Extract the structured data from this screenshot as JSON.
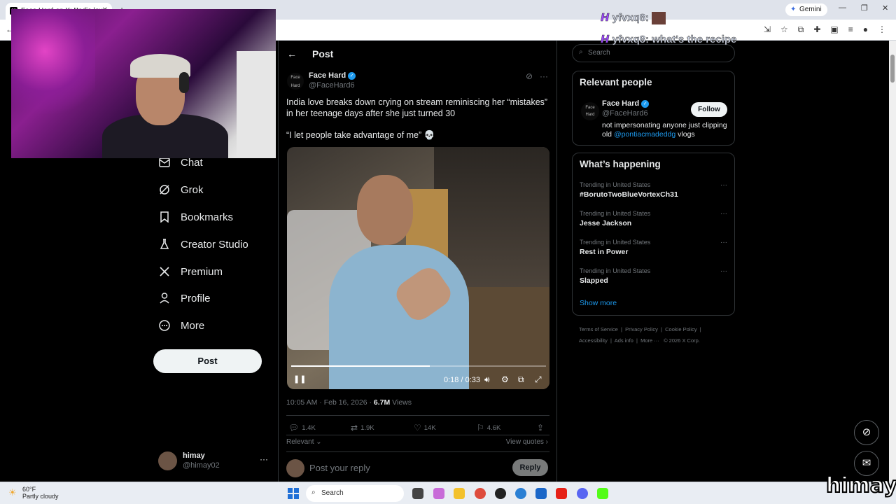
{
  "browser": {
    "tab_title": "Face Hard on X: \"India lov",
    "gemini_label": "Gemini"
  },
  "nav": {
    "items": [
      {
        "label": "Chat",
        "icon": "mail-icon"
      },
      {
        "label": "Grok",
        "icon": "grok-icon"
      },
      {
        "label": "Bookmarks",
        "icon": "bookmark-icon"
      },
      {
        "label": "Creator Studio",
        "icon": "flask-icon"
      },
      {
        "label": "Premium",
        "icon": "x-logo-icon"
      },
      {
        "label": "Profile",
        "icon": "person-icon"
      },
      {
        "label": "More",
        "icon": "more-circle-icon"
      }
    ],
    "post_button": "Post",
    "account": {
      "name": "himay",
      "handle": "@himay02"
    }
  },
  "post": {
    "header_title": "Post",
    "author": {
      "name": "Face Hard",
      "handle": "@FaceHard6",
      "avatar_text": "Face Hard"
    },
    "text": "India love breaks down crying on stream reminiscing her “mistakes” in her teenage days after she just turned 30",
    "quote": "“I let people take advantage of me” 💀",
    "video": {
      "time": "0:18 / 0:33",
      "progress": 0.545
    },
    "timestamp": "10:05 AM · Feb 16, 2026 · ",
    "views_count": "6.7M",
    "views_label": " Views",
    "stats": {
      "replies": "1.4K",
      "reposts": "1.9K",
      "likes": "14K",
      "bookmarks": "4.6K"
    },
    "sort_label": "Relevant",
    "view_quotes": "View quotes",
    "reply_placeholder": "Post your reply",
    "reply_button": "Reply"
  },
  "sidebar": {
    "search_placeholder": "Search",
    "relevant": {
      "title": "Relevant people",
      "name": "Face Hard",
      "handle": "@FaceHard6",
      "follow": "Follow",
      "bio_pre": "not impersonating anyone just clipping old ",
      "bio_link": "@pontiacmadeddg",
      "bio_post": " vlogs"
    },
    "happening": {
      "title": "What’s happening",
      "trends": [
        {
          "context": "Trending in United States",
          "title": "#BorutoTwoBlueVortexCh31"
        },
        {
          "context": "Trending in United States",
          "title": "Jesse Jackson"
        },
        {
          "context": "Trending in United States",
          "title": "Rest in Power"
        },
        {
          "context": "Trending in United States",
          "title": "Slapped"
        }
      ],
      "show_more": "Show more"
    },
    "footer_links": [
      "Terms of Service",
      "Privacy Policy",
      "Cookie Policy",
      "Accessibility",
      "Ads info",
      "More ···",
      "© 2026 X Corp."
    ]
  },
  "stream_chat": {
    "line1_user": "yfvxq8:",
    "line2_user": "yfvxq8:",
    "line2_msg": "what's the recipe"
  },
  "taskbar": {
    "temp": "60°F",
    "condition": "Partly cloudy",
    "search": "Search"
  },
  "overlay": {
    "streamer": "himay"
  }
}
